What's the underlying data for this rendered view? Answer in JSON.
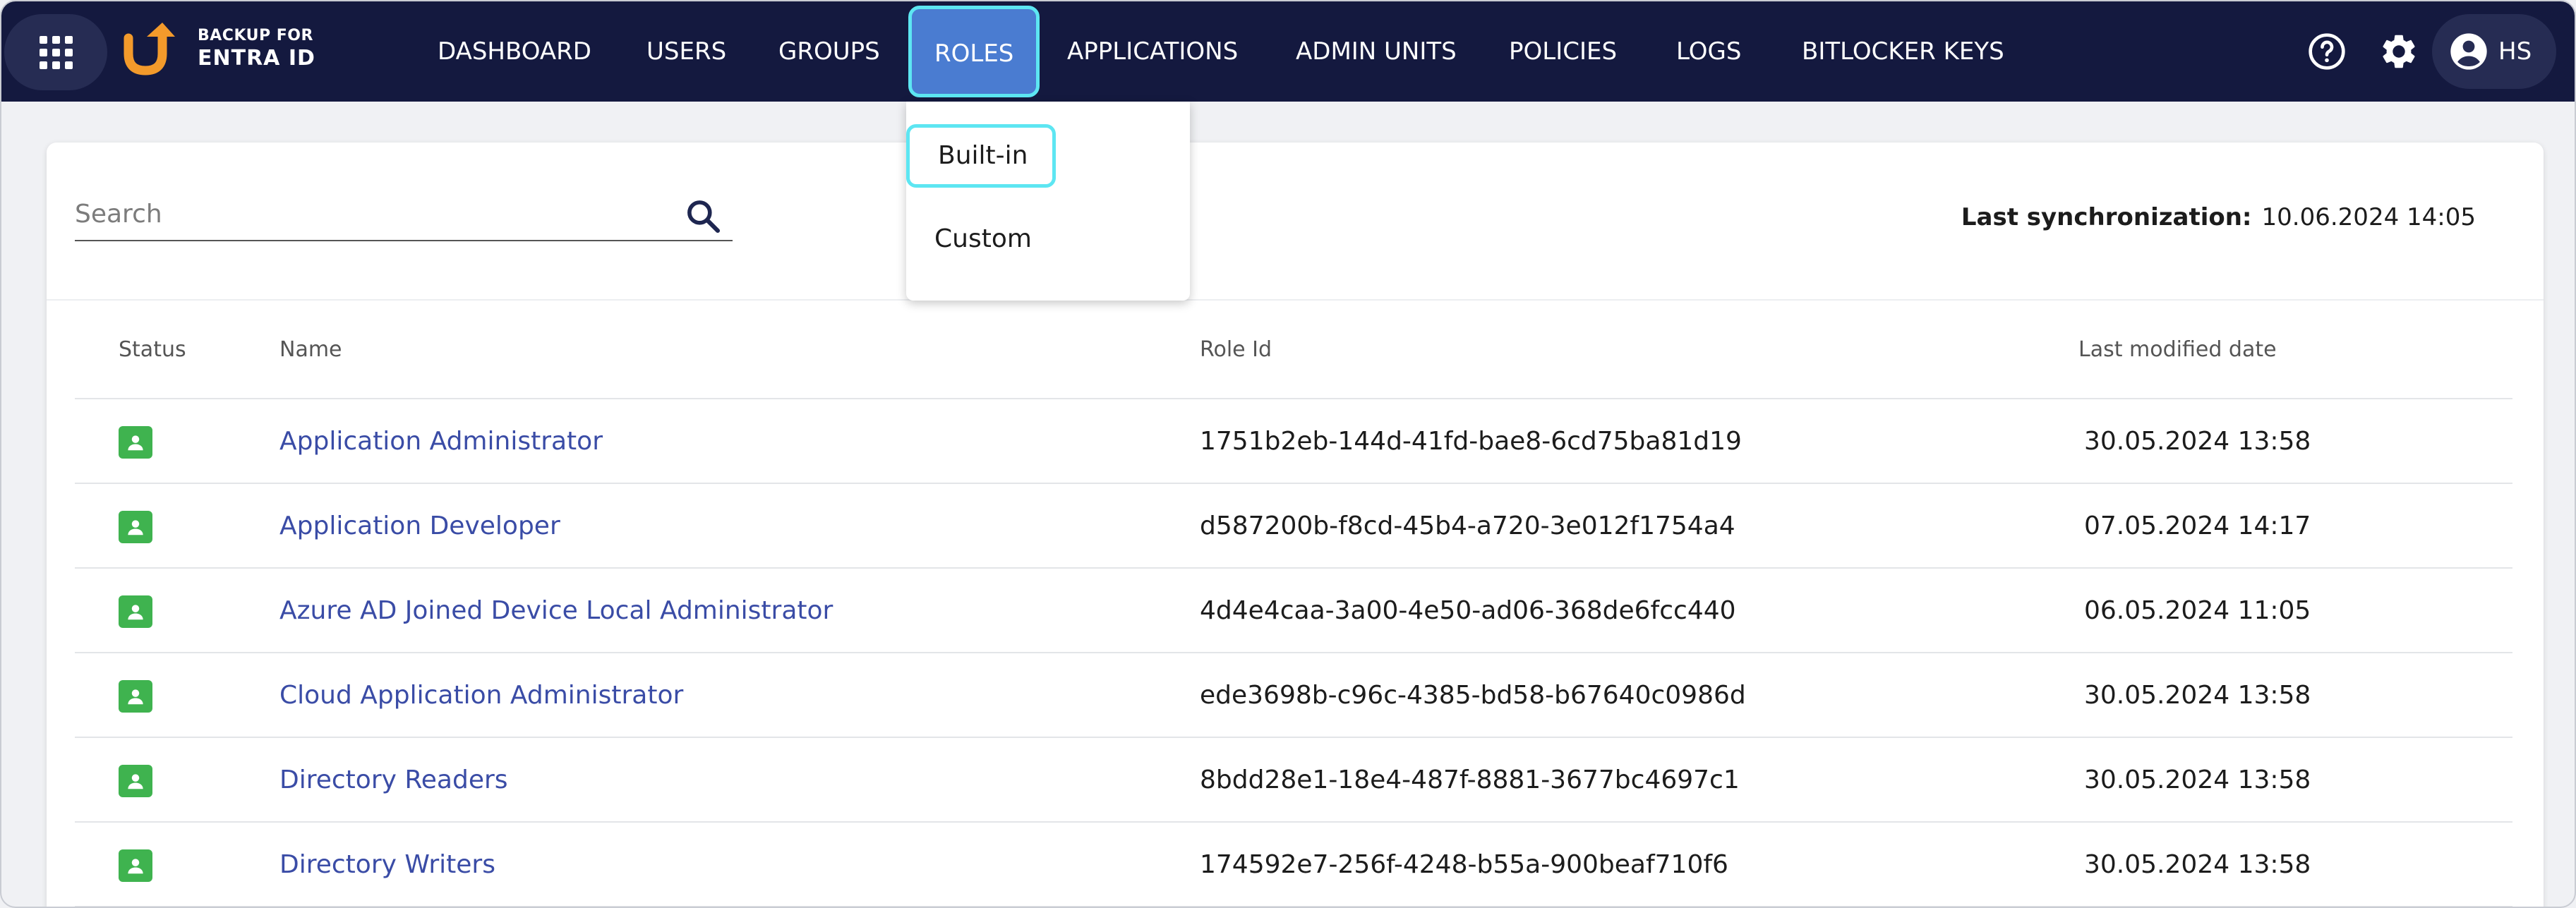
{
  "brand": {
    "line1": "BACKUP FOR",
    "line2": "ENTRA ID"
  },
  "nav": {
    "items": [
      "DASHBOARD",
      "USERS",
      "GROUPS",
      "ROLES",
      "APPLICATIONS",
      "ADMIN UNITS",
      "POLICIES",
      "LOGS",
      "BITLOCKER KEYS"
    ],
    "active": "ROLES"
  },
  "user": {
    "initials": "HS"
  },
  "roles_menu": {
    "items": [
      "Built-in",
      "Custom"
    ],
    "selected": "Built-in"
  },
  "search": {
    "placeholder": "Search"
  },
  "sync": {
    "label": "Last synchronization:",
    "value": "10.06.2024 14:05"
  },
  "table": {
    "headers": {
      "status": "Status",
      "name": "Name",
      "role_id": "Role Id",
      "modified": "Last modified date"
    },
    "rows": [
      {
        "name": "Application Administrator",
        "role_id": "1751b2eb-144d-41fd-bae8-6cd75ba81d19",
        "modified": "30.05.2024 13:58"
      },
      {
        "name": "Application Developer",
        "role_id": "d587200b-f8cd-45b4-a720-3e012f1754a4",
        "modified": "07.05.2024 14:17"
      },
      {
        "name": "Azure AD Joined Device Local Administrator",
        "role_id": "4d4e4caa-3a00-4e50-ad06-368de6fcc440",
        "modified": "06.05.2024 11:05"
      },
      {
        "name": "Cloud Application Administrator",
        "role_id": "ede3698b-c96c-4385-bd58-b67640c0986d",
        "modified": "30.05.2024 13:58"
      },
      {
        "name": "Directory Readers",
        "role_id": "8bdd28e1-18e4-487f-8881-3677bc4697c1",
        "modified": "30.05.2024 13:58"
      },
      {
        "name": "Directory Writers",
        "role_id": "174592e7-256f-4248-b55a-900beaf710f6",
        "modified": "30.05.2024 13:58"
      }
    ]
  },
  "colors": {
    "navbar": "#14193f",
    "active_tab": "#4a7cd1",
    "highlight": "#5de6f2",
    "status_green": "#3fb34f",
    "link": "#3a4ca6",
    "logo_orange": "#f39a2b"
  },
  "icons": {
    "apps": "grid-icon",
    "logo": "backup-logo-icon",
    "help": "help-icon",
    "settings": "gear-icon",
    "account": "account-circle-icon",
    "search": "search-icon",
    "status": "role-badge-icon"
  }
}
